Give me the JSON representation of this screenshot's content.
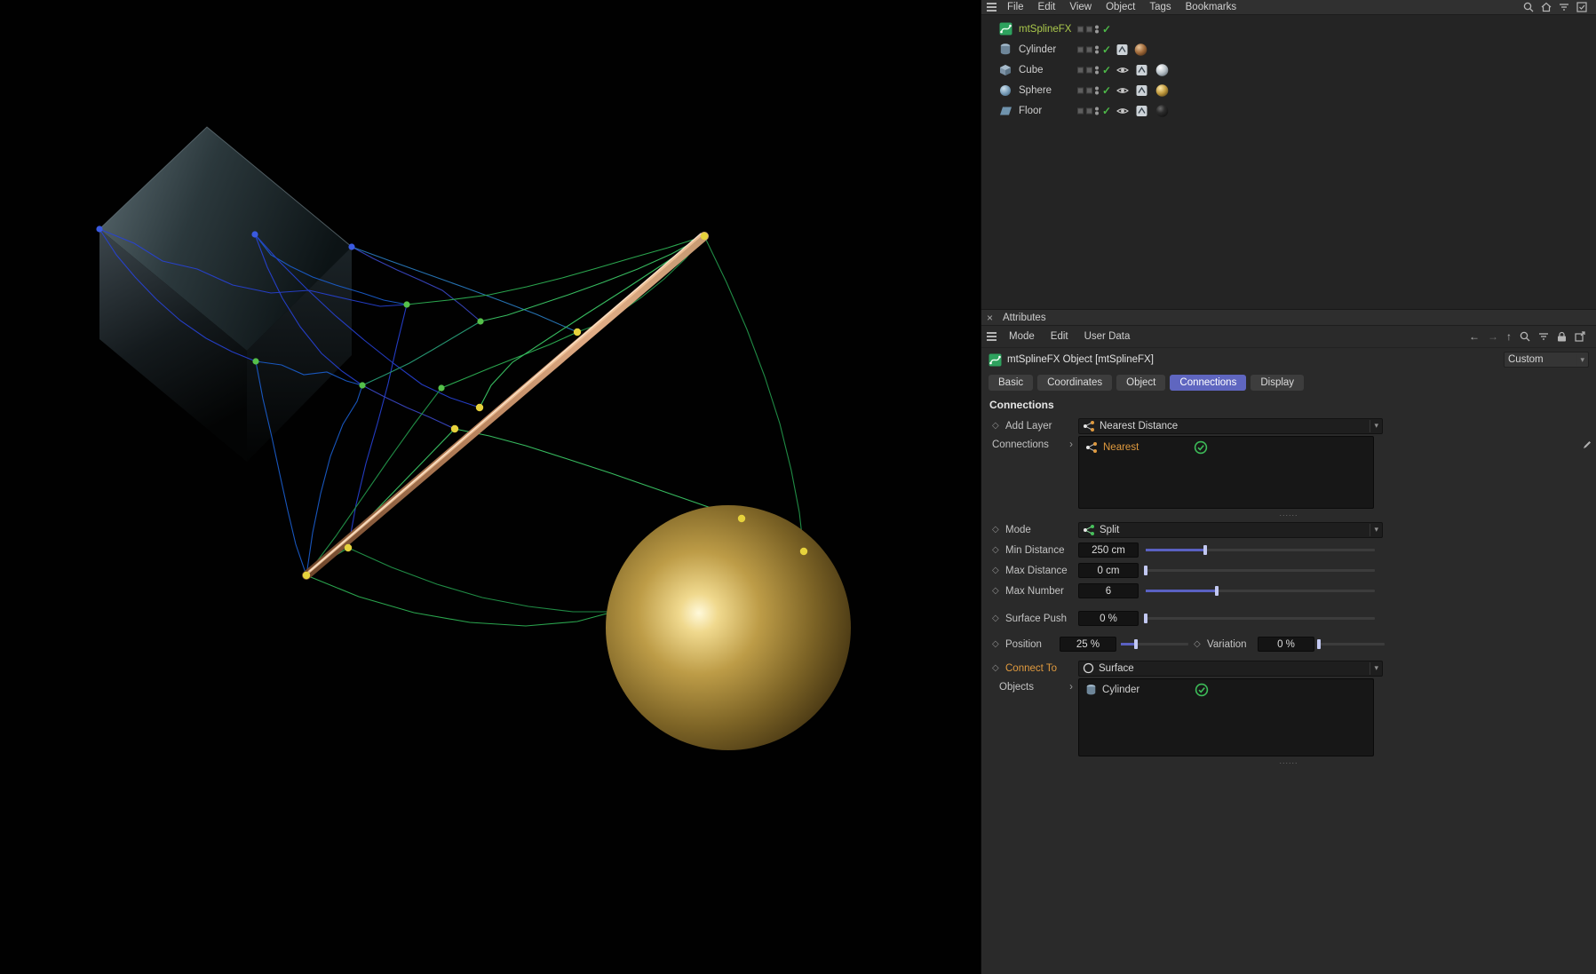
{
  "menu_bar": {
    "items": [
      "File",
      "Edit",
      "View",
      "Object",
      "Tags",
      "Bookmarks"
    ]
  },
  "object_manager": {
    "items": [
      {
        "name": "mtSplineFX",
        "icon": "splinefx-icon",
        "selected": true
      },
      {
        "name": "Cylinder",
        "icon": "cylinder-icon"
      },
      {
        "name": "Cube",
        "icon": "cube-icon"
      },
      {
        "name": "Sphere",
        "icon": "sphere-icon"
      },
      {
        "name": "Floor",
        "icon": "floor-icon"
      }
    ]
  },
  "attributes": {
    "title": "Attributes",
    "menu": {
      "items": [
        "Mode",
        "Edit",
        "User Data"
      ]
    },
    "object_title": "mtSplineFX Object [mtSplineFX]",
    "preset": "Custom",
    "tabs": [
      {
        "label": "Basic"
      },
      {
        "label": "Coordinates"
      },
      {
        "label": "Object"
      },
      {
        "label": "Connections",
        "active": true
      },
      {
        "label": "Display"
      }
    ],
    "section": "Connections",
    "add_layer": {
      "label": "Add Layer",
      "value": "Nearest Distance"
    },
    "connections_list": {
      "label": "Connections",
      "items": [
        {
          "name": "Nearest",
          "enabled": true
        }
      ]
    },
    "mode": {
      "label": "Mode",
      "value": "Split"
    },
    "min_distance": {
      "label": "Min Distance",
      "value": "250 cm",
      "slider_pct": 26
    },
    "max_distance": {
      "label": "Max Distance",
      "value": "0 cm",
      "slider_pct": 0
    },
    "max_number": {
      "label": "Max Number",
      "value": "6",
      "slider_pct": 31
    },
    "surface_push": {
      "label": "Surface Push",
      "value": "0 %",
      "slider_pct": 0
    },
    "position": {
      "label": "Position",
      "value": "25 %",
      "slider_pct": 22
    },
    "variation": {
      "label": "Variation",
      "value": "0 %",
      "slider_pct": 0
    },
    "connect_to": {
      "label": "Connect To",
      "value": "Surface"
    },
    "objects_list": {
      "label": "Objects",
      "items": [
        {
          "name": "Cylinder",
          "enabled": true
        }
      ]
    }
  },
  "icons": {
    "diamond": "◇",
    "check": "✓",
    "chevron": "›",
    "caret": "▾",
    "close": "×",
    "arrow_left": "←",
    "arrow_right": "→",
    "arrow_up": "↑",
    "dots_divider": "......"
  },
  "colors": {
    "active_tab": "#5f66c0",
    "selected_object_text": "#abc94c",
    "highlight_orange": "#e09a3e",
    "check_green": "#3dbb58",
    "slider_fill": "#5a61c2",
    "viewport_bg": "#010101",
    "panel_bg": "#2a2a2a"
  }
}
